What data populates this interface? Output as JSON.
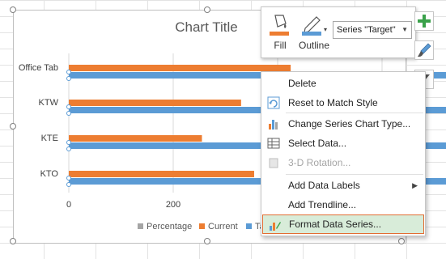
{
  "chart": {
    "title": "Chart Title",
    "categories": [
      "Office Tab",
      "KTW",
      "KTE",
      "KTO"
    ],
    "x_ticks": [
      "0",
      "200",
      "400",
      "600"
    ],
    "legend": [
      {
        "label": "Percentage",
        "color": "#a5a5a5"
      },
      {
        "label": "Current",
        "color": "#ed7d31"
      },
      {
        "label": "Ta",
        "color": "#5b9bd5"
      }
    ]
  },
  "chart_data": {
    "type": "bar",
    "orientation": "horizontal",
    "title": "Chart Title",
    "categories": [
      "Office Tab",
      "KTW",
      "KTE",
      "KTO"
    ],
    "series": [
      {
        "name": "Current",
        "color": "#ed7d31",
        "values": [
          425,
          330,
          255,
          355
        ]
      },
      {
        "name": "Target",
        "color": "#5b9bd5",
        "values": [
          1000,
          1000,
          1000,
          1000
        ]
      }
    ],
    "xlim": [
      0,
      1000
    ],
    "x_ticks": [
      0,
      200,
      400,
      600
    ],
    "legend_placement": "bottom",
    "grid": true
  },
  "mini_toolbar": {
    "fill_label": "Fill",
    "outline_label": "Outline",
    "series_selector": "Series \"Target\""
  },
  "context_menu": {
    "items": [
      {
        "label": "Delete",
        "icon": "none",
        "disabled": false
      },
      {
        "label": "Reset to Match Style",
        "icon": "reset-style-icon",
        "disabled": false
      },
      {
        "label": "Change Series Chart Type...",
        "icon": "chart-type-icon",
        "disabled": false
      },
      {
        "label": "Select Data...",
        "icon": "select-data-icon",
        "disabled": false
      },
      {
        "label": "3-D Rotation...",
        "icon": "rotation-3d-icon",
        "disabled": true
      },
      {
        "label": "Add Data Labels",
        "icon": "none",
        "disabled": false,
        "submenu": true
      },
      {
        "label": "Add Trendline...",
        "icon": "none",
        "disabled": false
      },
      {
        "label": "Format Data Series...",
        "icon": "format-series-icon",
        "disabled": false,
        "highlighted": true
      }
    ]
  },
  "colors": {
    "accent_orange": "#ed7d31",
    "accent_blue": "#5b9bd5",
    "highlight_bg": "#d8ecd9",
    "highlight_border": "#e26c32"
  }
}
